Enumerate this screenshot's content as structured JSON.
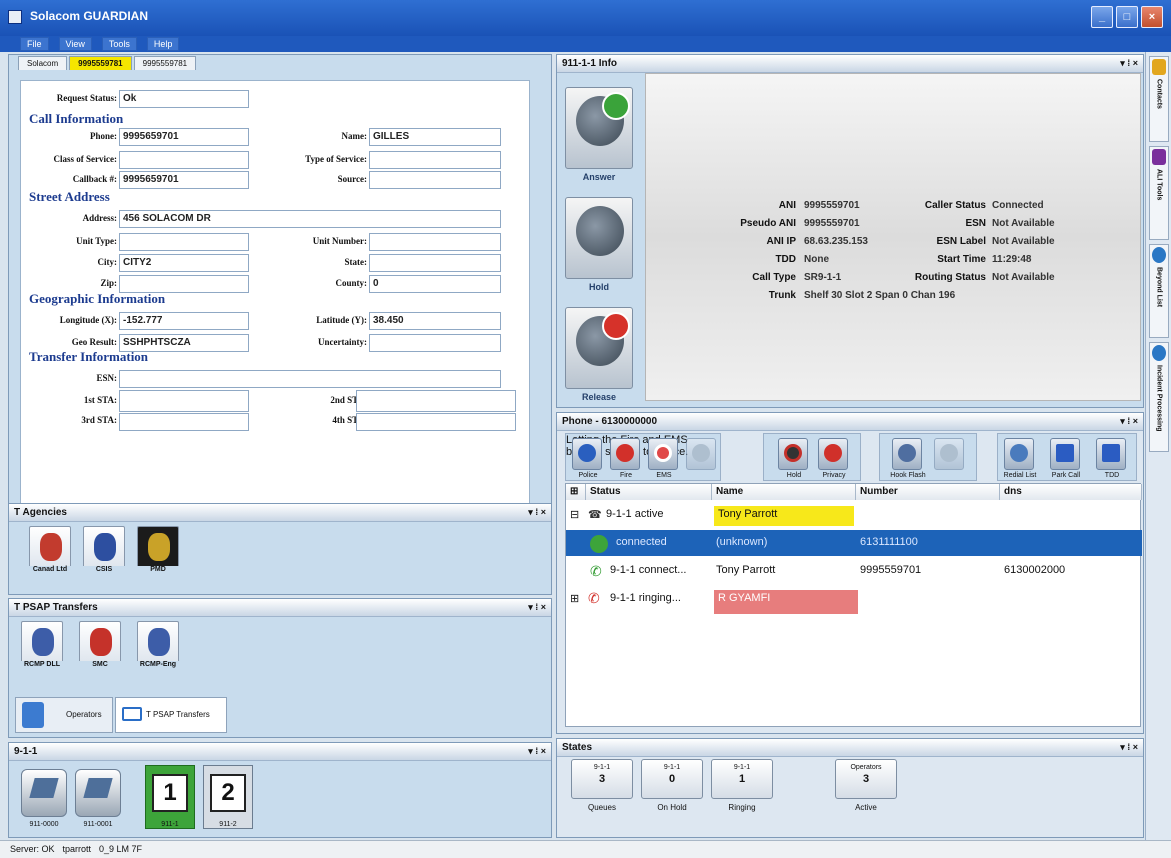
{
  "window": {
    "title": "Solacom GUARDIAN"
  },
  "menu": [
    "File",
    "View",
    "Tools",
    "Help"
  ],
  "tabs": [
    "Solacom",
    "9995559781",
    "9995559781"
  ],
  "form": {
    "request_status_label": "Request Status:",
    "request_status": "Ok",
    "call_info": "Call Information",
    "phone_label": "Phone:",
    "phone": "9995659701",
    "name_label": "Name:",
    "name": "GILLES",
    "cos_label": "Class of Service:",
    "cos": "",
    "tos_label": "Type of Service:",
    "tos": "",
    "callback_label": "Callback #:",
    "callback": "9995659701",
    "source_label": "Source:",
    "source": "",
    "street": "Street Address",
    "address_label": "Address:",
    "address": "456  SOLACOM  DR",
    "unit_type_label": "Unit Type:",
    "unit_type": "",
    "unit_number_label": "Unit Number:",
    "unit_number": "",
    "city_label": "City:",
    "city": "CITY2",
    "state_label": "State:",
    "state": "",
    "zip_label": "Zip:",
    "zip": "",
    "county_label": "County:",
    "county": "0",
    "geo": "Geographic Information",
    "lon_label": "Longitude (X):",
    "lon": "-152.777",
    "lat_label": "Latitude (Y):",
    "lat": "38.450",
    "geo_result_label": "Geo Result:",
    "geo_result": "SSHPHTSCZA",
    "uncert_label": "Uncertainty:",
    "uncert": "",
    "transfer": "Transfer Information",
    "esn_label": "ESN:",
    "esn": "",
    "sta1_label": "1st STA:",
    "sta1": "",
    "sta2_label": "2nd STA:",
    "sta2": "",
    "sta3_label": "3rd STA:",
    "sta3": "",
    "sta4_label": "4th STA:",
    "sta4": ""
  },
  "agencies": {
    "title": "T Agencies",
    "items": [
      "Canad Ltd",
      "CSIS",
      "PMD"
    ]
  },
  "psap": {
    "title": "T PSAP Transfers",
    "items": [
      "RCMP DLL",
      "SMC",
      "RCMP-Eng"
    ],
    "operators_label": "Operators",
    "transfer_tab": "T PSAP Transfers"
  },
  "nine11": {
    "title": "9-1-1",
    "lines": [
      "911-0000",
      "911-0001",
      "911-1",
      "911-2"
    ],
    "line1": "1",
    "line2": "2"
  },
  "info": {
    "title": "911-1-1 Info",
    "answer": "Answer",
    "hold": "Hold",
    "release": "Release",
    "ani_label": "ANI",
    "ani": "9995559701",
    "pani_label": "Pseudo ANI",
    "pani": "9995559701",
    "aniip_label": "ANI IP",
    "aniip": "68.63.235.153",
    "tdd_label": "TDD",
    "tdd": "None",
    "ctype_label": "Call Type",
    "ctype": "SR9-1-1",
    "trunk_label": "Trunk",
    "trunk": "Shelf 30 Slot 2 Span 0 Chan 196",
    "cstat_label": "Caller Status",
    "cstat": "Connected",
    "esnk_label": "ESN",
    "esnv": "Not Available",
    "esnl_label": "ESN Label",
    "esnl": "Not Available",
    "start_label": "Start Time",
    "start": "11:29:48",
    "route_label": "Routing Status",
    "route": "Not Available"
  },
  "phone": {
    "title": "Phone - 6130000000",
    "buttons": [
      "Police",
      "Fire",
      "EMS",
      "",
      "Hold",
      "Privacy",
      "Hook Flash",
      "",
      "Redial List",
      "Park Call",
      "TDD"
    ],
    "cols": [
      "Status",
      "Name",
      "Number",
      "dns"
    ],
    "rows": [
      {
        "status": "9-1-1 active",
        "name": "Tony Parrott",
        "number": "",
        "dns": ""
      },
      {
        "status": "connected",
        "name": "(unknown)",
        "number": "6131111100",
        "dns": ""
      },
      {
        "status": "9-1-1 connect...",
        "name": "Tony Parrott",
        "number": "9995559701",
        "dns": "6130002000"
      },
      {
        "status": "9-1-1 ringing...",
        "name": "R GYAMFI",
        "number": "",
        "dns": ""
      }
    ]
  },
  "statesPanel": {
    "title": "States",
    "items": [
      {
        "head": "9-1-1",
        "val": "3",
        "lab": "Queues"
      },
      {
        "head": "9-1-1",
        "val": "0",
        "lab": "On Hold"
      },
      {
        "head": "9-1-1",
        "val": "1",
        "lab": "Ringing"
      },
      {
        "head": "Operators",
        "val": "3",
        "lab": "Active"
      }
    ]
  },
  "side": [
    "Contacts",
    "ALI Tools",
    "Beyond List",
    "Incident Processing"
  ],
  "statusbar": {
    "server": "Server: OK",
    "user": "tparrott",
    "pos": "0_9 LM 7F"
  },
  "colors": {
    "accent": "#1f59bd",
    "panel": "#c8dced",
    "highlight": "#f7e81a",
    "selected": "#1d63b8",
    "ringing": "#e77d7d"
  }
}
